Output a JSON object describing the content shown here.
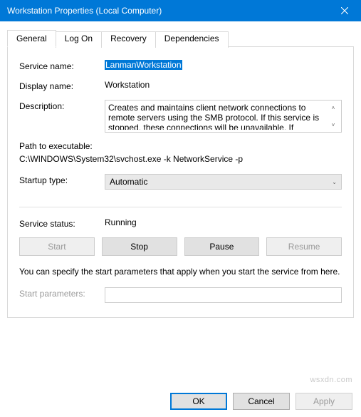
{
  "window": {
    "title": "Workstation Properties (Local Computer)"
  },
  "tabs": {
    "general": "General",
    "logon": "Log On",
    "recovery": "Recovery",
    "dependencies": "Dependencies"
  },
  "labels": {
    "service_name": "Service name:",
    "display_name": "Display name:",
    "description": "Description:",
    "path": "Path to executable:",
    "startup_type": "Startup type:",
    "service_status": "Service status:",
    "start_parameters": "Start parameters:"
  },
  "values": {
    "service_name": "LanmanWorkstation",
    "display_name": "Workstation",
    "description": "Creates and maintains client network connections to remote servers using the SMB protocol. If this service is stopped, these connections will be unavailable. If",
    "path": "C:\\WINDOWS\\System32\\svchost.exe -k NetworkService -p",
    "startup_type": "Automatic",
    "service_status": "Running",
    "start_parameters": ""
  },
  "buttons": {
    "start": "Start",
    "stop": "Stop",
    "pause": "Pause",
    "resume": "Resume",
    "ok": "OK",
    "cancel": "Cancel",
    "apply": "Apply"
  },
  "note": "You can specify the start parameters that apply when you start the service from here.",
  "watermark": "wsxdn.com"
}
